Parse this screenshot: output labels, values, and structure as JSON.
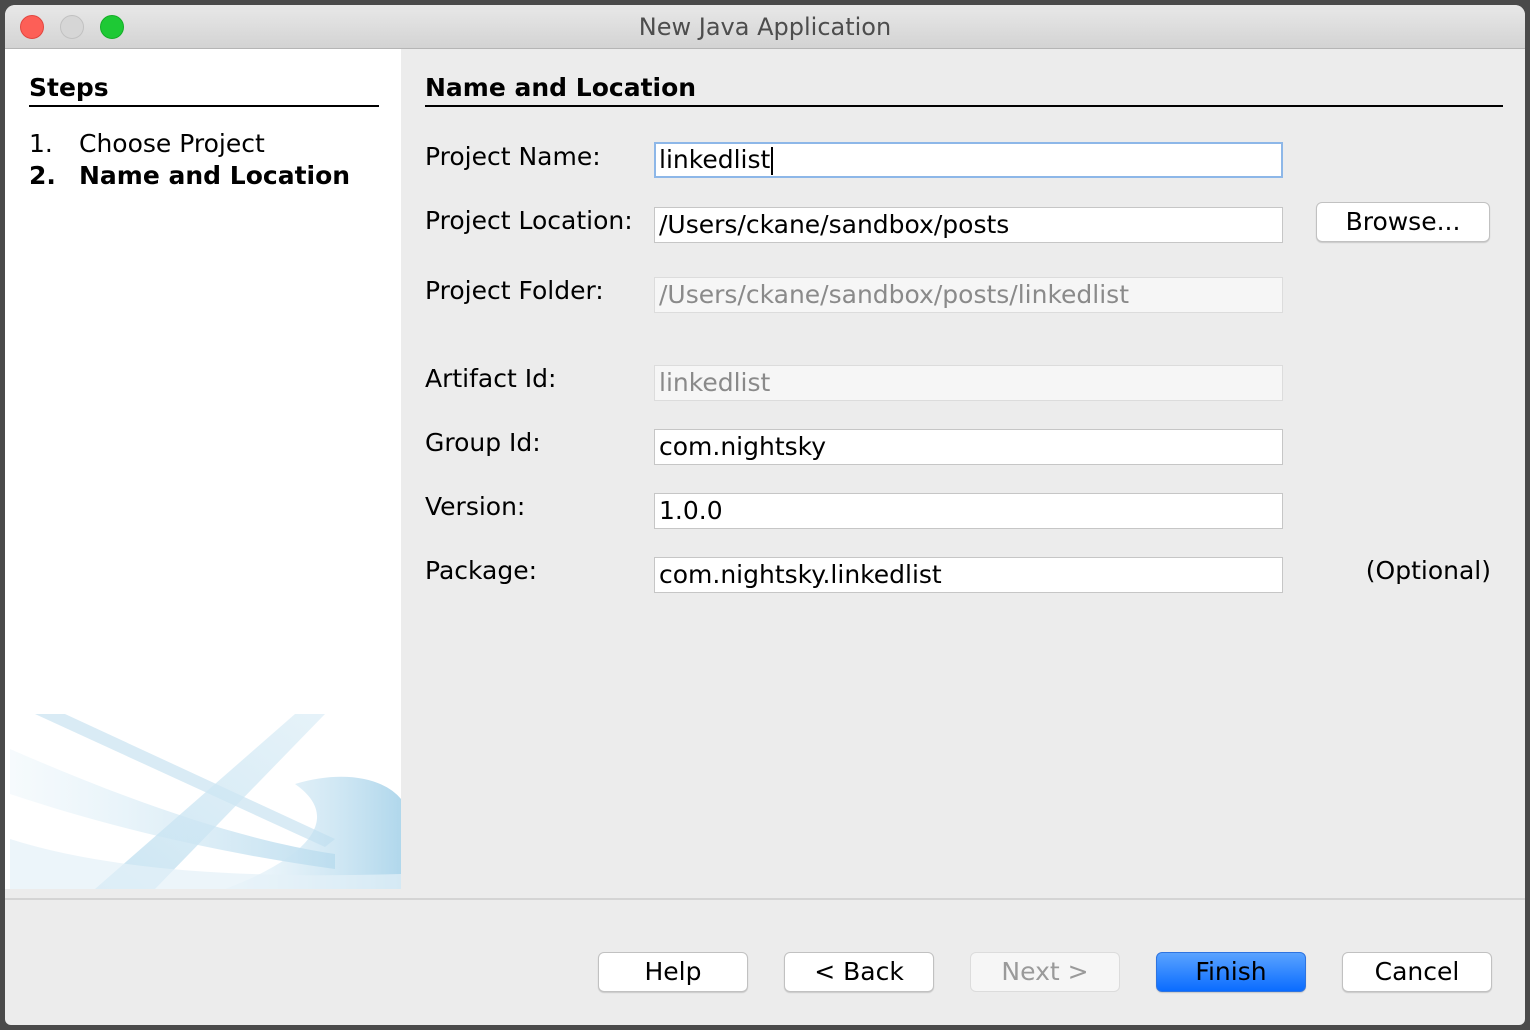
{
  "window": {
    "title": "New Java Application",
    "controls": [
      "close",
      "minimize",
      "maximize"
    ]
  },
  "steps": {
    "title": "Steps",
    "items": [
      {
        "number": "1.",
        "label": "Choose Project",
        "current": false
      },
      {
        "number": "2.",
        "label": "Name and Location",
        "current": true
      }
    ]
  },
  "form": {
    "section_title": "Name and Location",
    "project_name": {
      "label": "Project Name:",
      "value": "linkedlist",
      "focused": true
    },
    "project_location": {
      "label": "Project Location:",
      "value": "/Users/ckane/sandbox/posts"
    },
    "project_folder": {
      "label": "Project Folder:",
      "value": "/Users/ckane/sandbox/posts/linkedlist",
      "enabled": false
    },
    "artifact_id": {
      "label": "Artifact Id:",
      "value": "linkedlist",
      "enabled": false
    },
    "group_id": {
      "label": "Group Id:",
      "value": "com.nightsky"
    },
    "version": {
      "label": "Version:",
      "value": "1.0.0"
    },
    "package": {
      "label": "Package:",
      "value": "com.nightsky.linkedlist",
      "hint": "(Optional)"
    },
    "browse_label": "Browse..."
  },
  "buttons": {
    "help": "Help",
    "back": "< Back",
    "next": "Next >",
    "finish": "Finish",
    "cancel": "Cancel"
  },
  "colors": {
    "primary_button": "#0a6cff",
    "focus_ring": "#8db7e8",
    "close": "#fd5f57",
    "maximize": "#1ec935"
  }
}
